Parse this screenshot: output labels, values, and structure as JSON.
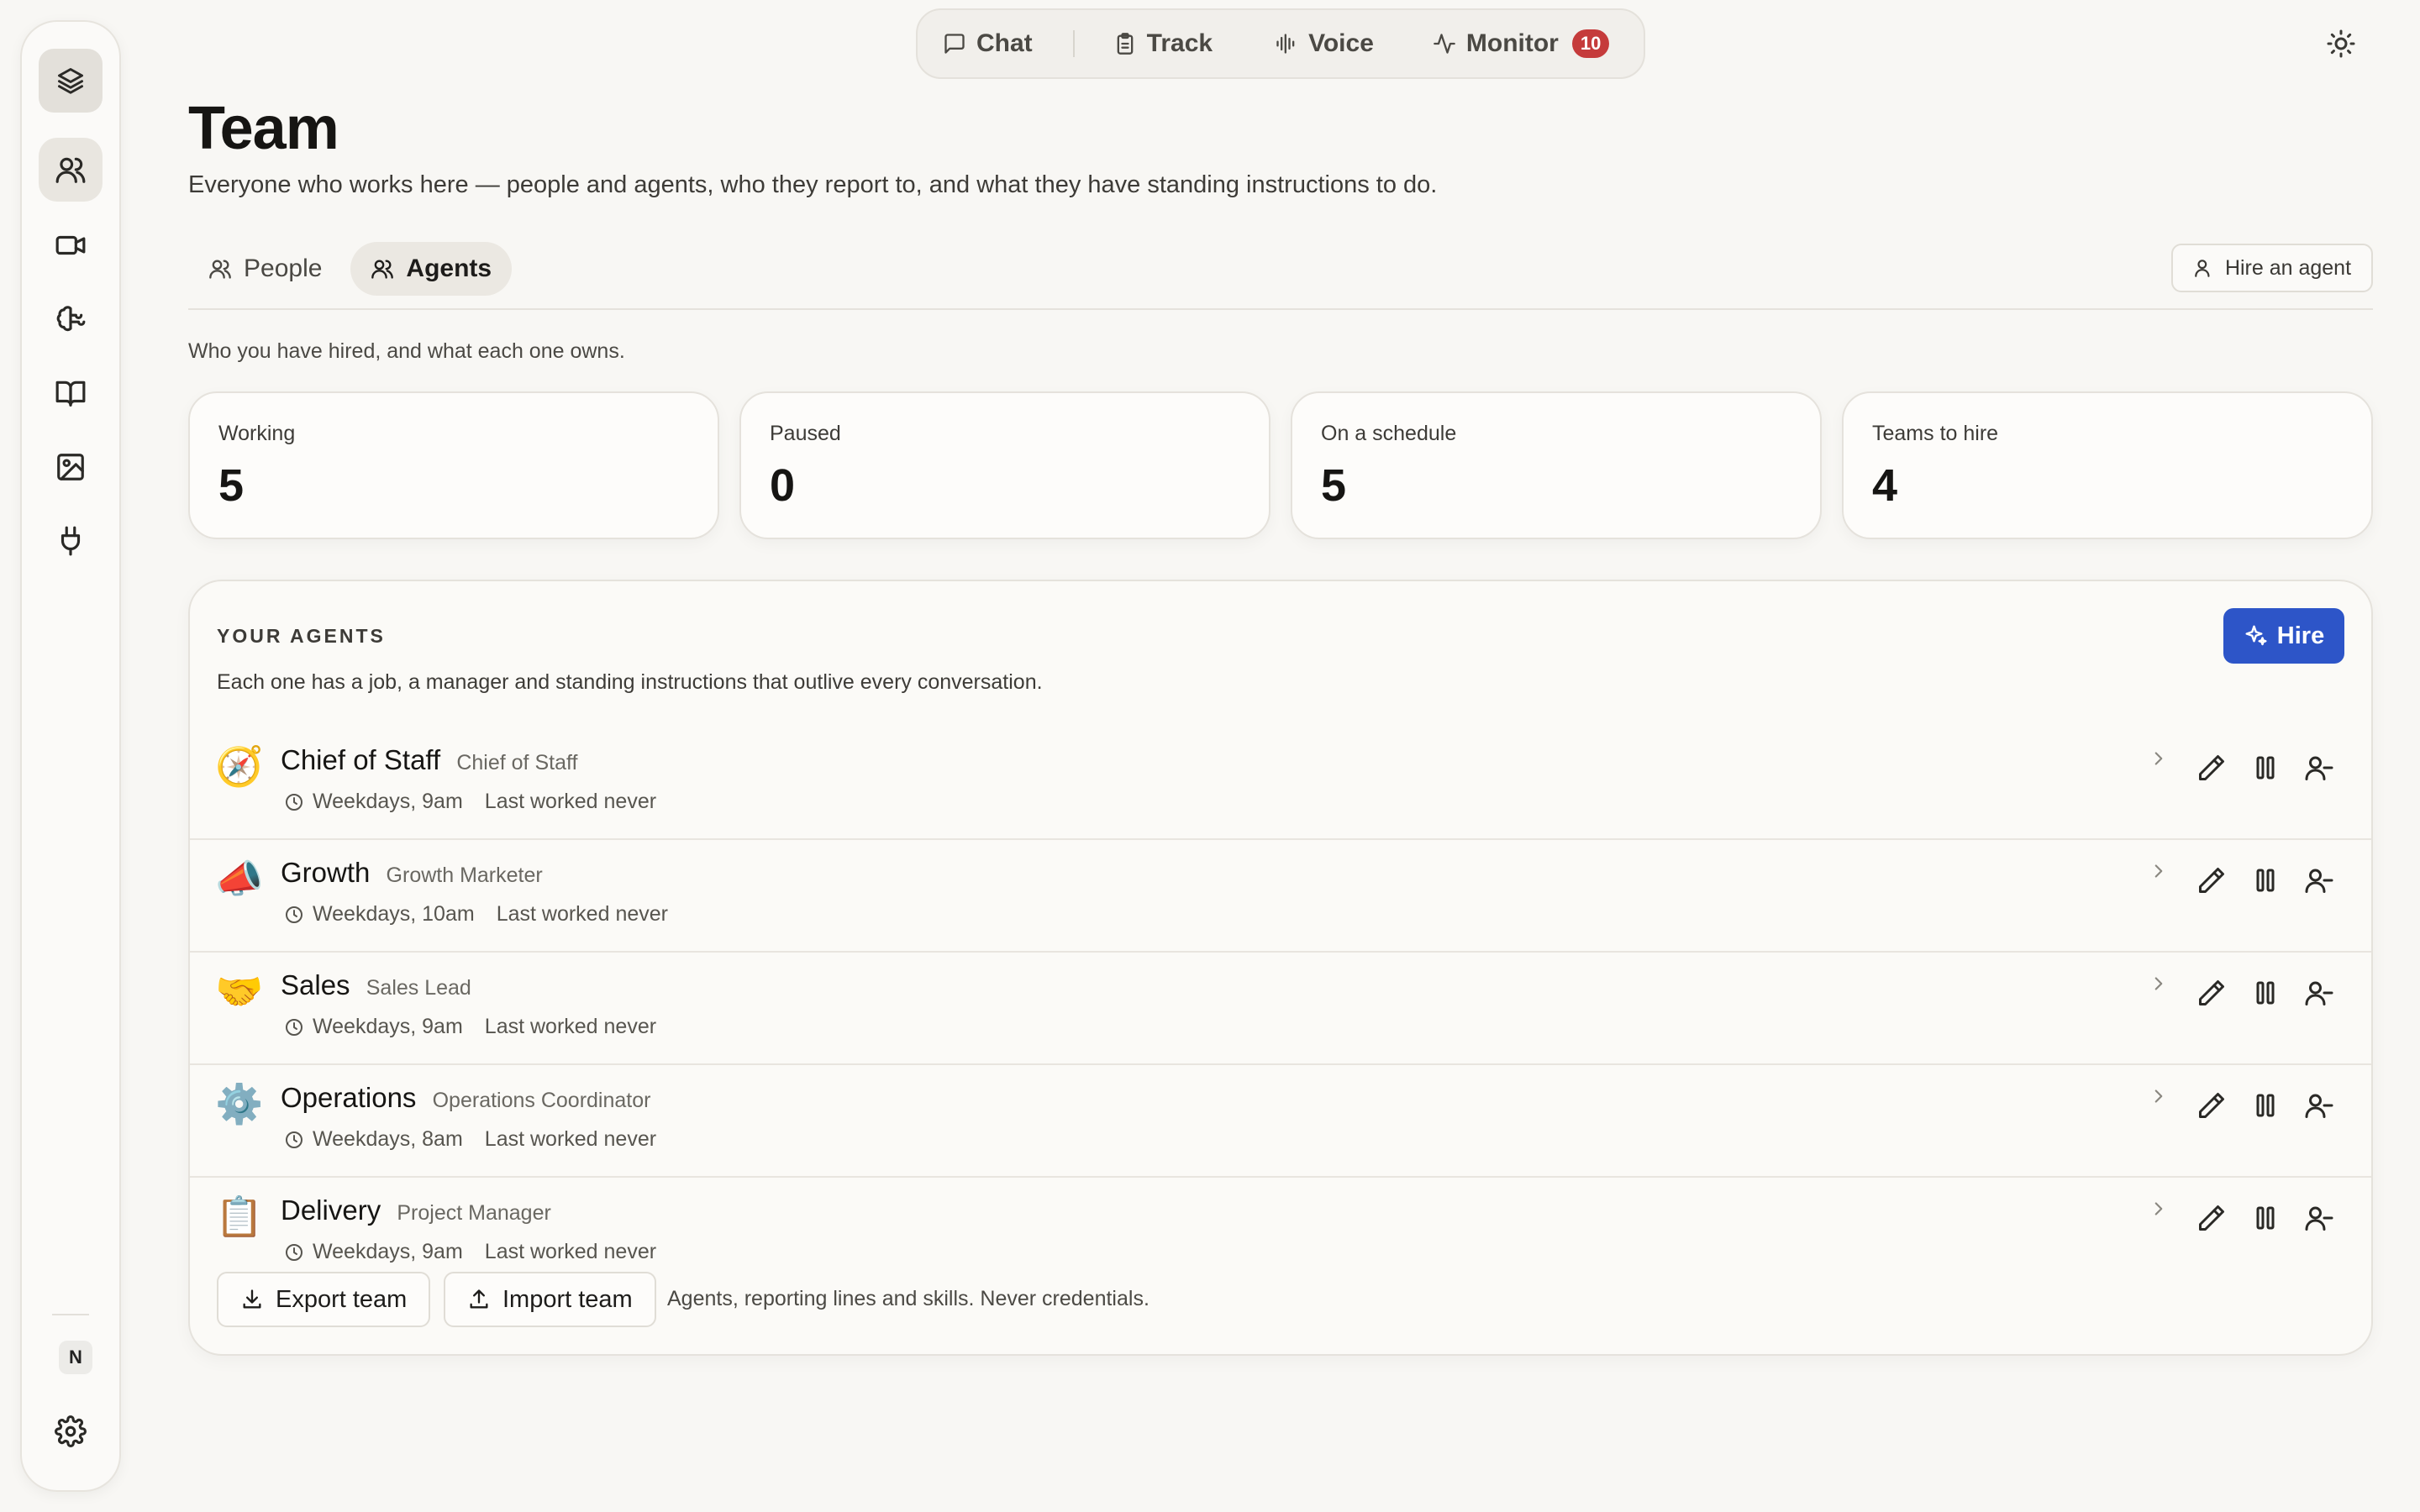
{
  "nav": {
    "items": [
      {
        "label": "Chat",
        "icon": "message-square-icon"
      },
      {
        "label": "Track",
        "icon": "clipboard-icon"
      },
      {
        "label": "Voice",
        "icon": "audio-wave-icon"
      },
      {
        "label": "Monitor",
        "icon": "activity-icon",
        "badge": "10"
      }
    ],
    "theme_icon": "sun-icon"
  },
  "sidebar": {
    "items": [
      "layers-icon",
      "users-icon",
      "video-icon",
      "brain-icon",
      "book-open-icon",
      "image-icon",
      "plug-icon"
    ],
    "active": "users-icon",
    "user_initial": "N",
    "settings_icon": "settings-icon"
  },
  "page": {
    "title": "Team",
    "subtitle": "Everyone who works here — people and agents, who they report to, and what they have standing instructions to do."
  },
  "tabs": [
    {
      "label": "People",
      "active": false
    },
    {
      "label": "Agents",
      "active": true
    }
  ],
  "hire_agent_label": "Hire an agent",
  "section_note": "Who you have hired, and what each one owns.",
  "stats": [
    {
      "label": "Working",
      "value": "5"
    },
    {
      "label": "Paused",
      "value": "0"
    },
    {
      "label": "On a schedule",
      "value": "5"
    },
    {
      "label": "Teams to hire",
      "value": "4"
    }
  ],
  "agents_panel": {
    "heading": "YOUR AGENTS",
    "subtitle": "Each one has a job, a manager and standing instructions that outlive every conversation.",
    "hire_label": "Hire",
    "hire_color": "#2d55c8",
    "agents": [
      {
        "emoji": "🧭",
        "name": "Chief of Staff",
        "role": "Chief of Staff",
        "schedule": "Weekdays, 9am",
        "last_worked": "Last worked never"
      },
      {
        "emoji": "📣",
        "name": "Growth",
        "role": "Growth Marketer",
        "schedule": "Weekdays, 10am",
        "last_worked": "Last worked never"
      },
      {
        "emoji": "🤝",
        "name": "Sales",
        "role": "Sales Lead",
        "schedule": "Weekdays, 9am",
        "last_worked": "Last worked never"
      },
      {
        "emoji": "⚙️",
        "name": "Operations",
        "role": "Operations Coordinator",
        "schedule": "Weekdays, 8am",
        "last_worked": "Last worked never"
      },
      {
        "emoji": "📋",
        "name": "Delivery",
        "role": "Project Manager",
        "schedule": "Weekdays, 9am",
        "last_worked": "Last worked never"
      }
    ],
    "export_label": "Export team",
    "import_label": "Import team",
    "footer_note": "Agents, reporting lines and skills. Never credentials."
  },
  "colors": {
    "background": "#f8f7f4",
    "badge": "#c53b3b",
    "accent": "#2d55c8"
  }
}
